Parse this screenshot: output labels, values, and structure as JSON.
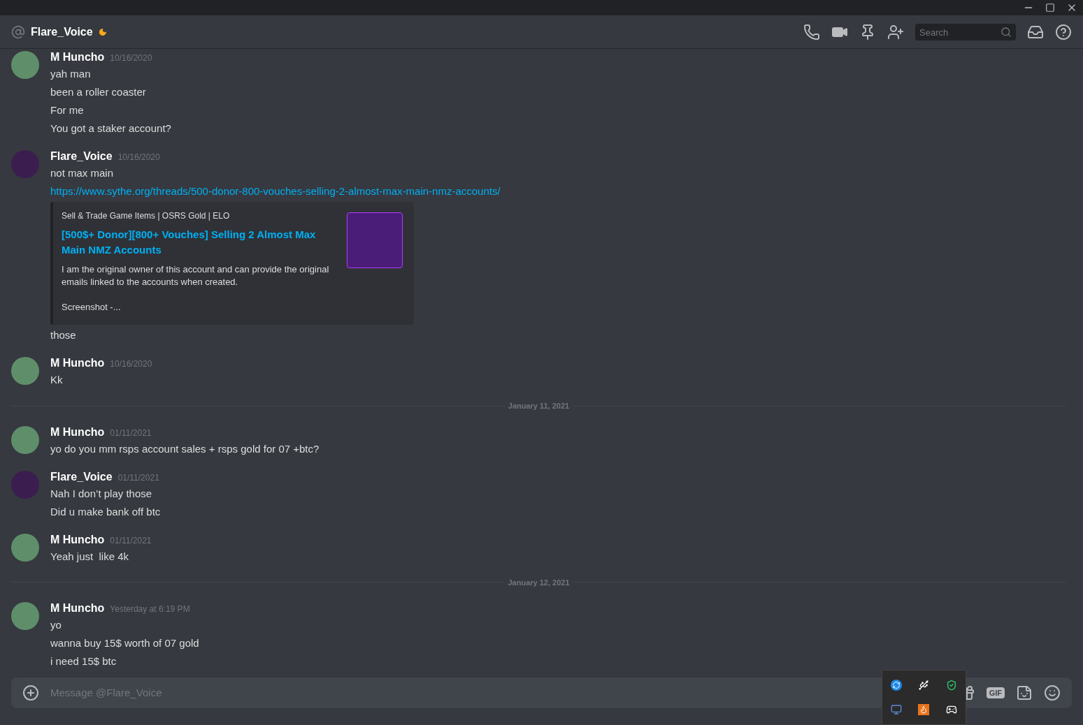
{
  "header": {
    "channel": "Flare_Voice",
    "search": {
      "placeholder": "Search"
    }
  },
  "messages": [
    {
      "kind": "message",
      "author": "M Huncho",
      "timestamp": "10/16/2020",
      "color": "#5f8f6a",
      "lines": [
        {
          "kind": "text",
          "text": "yah man"
        },
        {
          "kind": "text",
          "text": "been a roller coaster"
        },
        {
          "kind": "text",
          "text": "For me"
        },
        {
          "kind": "text",
          "text": "You got a staker account?"
        }
      ]
    },
    {
      "kind": "message",
      "author": "Flare_Voice",
      "timestamp": "10/16/2020",
      "color": "#3b1d4f",
      "lines": [
        {
          "kind": "text",
          "text": "not max main"
        },
        {
          "kind": "link",
          "text": "https://www.sythe.org/threads/500-donor-800-vouches-selling-2-almost-max-main-nmz-accounts/"
        },
        {
          "kind": "embed",
          "provider": "Sell & Trade Game Items | OSRS Gold | ELO",
          "title": "[500$+ Donor][800+ Vouches] Selling 2 Almost Max Main NMZ Accounts",
          "description": [
            "I am the original owner of this account and can provide the original emails linked to the accounts when created.",
            "Screenshot -..."
          ]
        },
        {
          "kind": "text",
          "text": "those"
        }
      ]
    },
    {
      "kind": "message",
      "author": "M Huncho",
      "timestamp": "10/16/2020",
      "color": "#5f8f6a",
      "lines": [
        {
          "kind": "text",
          "text": "Kk"
        }
      ]
    },
    {
      "kind": "divider",
      "text": "January 11, 2021"
    },
    {
      "kind": "message",
      "author": "M Huncho",
      "timestamp": "01/11/2021",
      "color": "#5f8f6a",
      "lines": [
        {
          "kind": "text",
          "text": "yo do you mm rsps account sales + rsps gold for 07 +btc?"
        }
      ]
    },
    {
      "kind": "message",
      "author": "Flare_Voice",
      "timestamp": "01/11/2021",
      "color": "#3b1d4f",
      "lines": [
        {
          "kind": "text",
          "text": "Nah I don’t play those"
        },
        {
          "kind": "text",
          "text": "Did u make bank off btc"
        }
      ]
    },
    {
      "kind": "message",
      "author": "M Huncho",
      "timestamp": "01/11/2021",
      "color": "#5f8f6a",
      "lines": [
        {
          "kind": "text",
          "text": "Yeah just  like 4k"
        }
      ]
    },
    {
      "kind": "divider",
      "text": "January 12, 2021"
    },
    {
      "kind": "message",
      "author": "M Huncho",
      "timestamp": "Yesterday at 6:19 PM",
      "color": "#5f8f6a",
      "lines": [
        {
          "kind": "text",
          "text": "yo"
        },
        {
          "kind": "text",
          "text": "wanna buy 15$ worth of 07 gold"
        },
        {
          "kind": "text",
          "text": "i need 15$ btc"
        }
      ]
    }
  ],
  "composer": {
    "placeholder": "Message @Flare_Voice",
    "gif_label": "GIF"
  }
}
